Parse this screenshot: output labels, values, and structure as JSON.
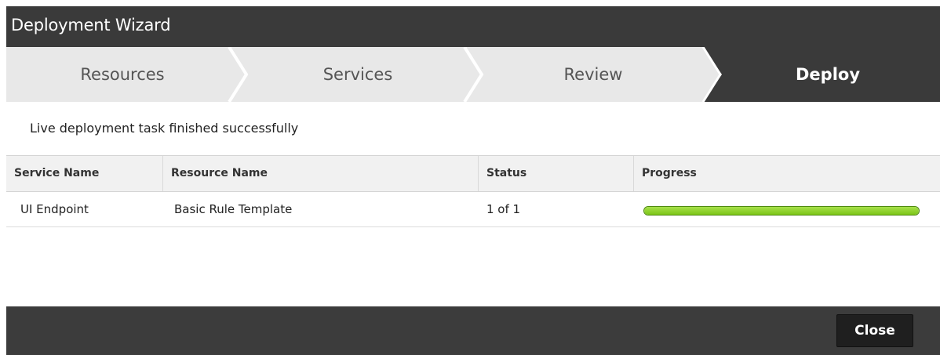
{
  "window": {
    "title": "Deployment Wizard"
  },
  "steps": [
    {
      "label": "Resources",
      "active": false
    },
    {
      "label": "Services",
      "active": false
    },
    {
      "label": "Review",
      "active": false
    },
    {
      "label": "Deploy",
      "active": true
    }
  ],
  "message": "Live deployment task finished successfully",
  "table": {
    "columns": [
      "Service Name",
      "Resource Name",
      "Status",
      "Progress"
    ],
    "rows": [
      {
        "service": "UI Endpoint",
        "resource": "Basic Rule Template",
        "status": "1 of 1",
        "progress": 1.0
      }
    ]
  },
  "colors": {
    "titlebar": "#3a3a3a",
    "active_step": "#3a3a3a",
    "inactive_step": "#e8e8e8",
    "progress_fill": "#7cc518"
  },
  "footer": {
    "close_label": "Close"
  }
}
